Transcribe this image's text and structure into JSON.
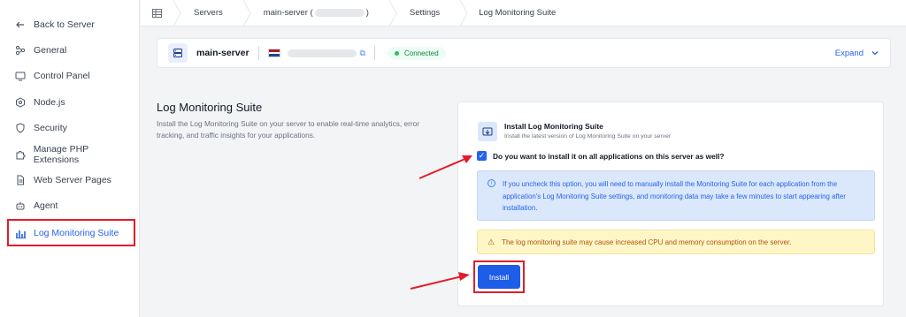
{
  "sidebar": {
    "items": [
      {
        "label": "Back to Server",
        "icon": "arrow-left-icon"
      },
      {
        "label": "General",
        "icon": "settings-nodes-icon"
      },
      {
        "label": "Control Panel",
        "icon": "monitor-icon"
      },
      {
        "label": "Node.js",
        "icon": "nodejs-icon"
      },
      {
        "label": "Security",
        "icon": "shield-icon"
      },
      {
        "label": "Manage PHP Extensions",
        "icon": "puzzle-icon"
      },
      {
        "label": "Web Server Pages",
        "icon": "document-icon"
      },
      {
        "label": "Agent",
        "icon": "robot-icon"
      },
      {
        "label": "Log Monitoring Suite",
        "icon": "bar-chart-icon"
      }
    ],
    "active_index": 8
  },
  "breadcrumb": {
    "items": [
      "Servers",
      "main-server (",
      ")",
      "Settings",
      "Log Monitoring Suite"
    ]
  },
  "server_header": {
    "name": "main-server",
    "status": "Connected",
    "expand_label": "Expand"
  },
  "section": {
    "title": "Log Monitoring Suite",
    "description": "Install the Log Monitoring Suite on your server to enable real-time analytics, error tracking, and traffic insights for your applications."
  },
  "install_panel": {
    "title": "Install Log Monitoring Suite",
    "subtitle": "Install the latest version of Log Monitoring Suite on your server",
    "checkbox_label": "Do you want to install it on all applications on this server as well?",
    "checkbox_checked": true,
    "info_text": "If you uncheck this option, you will need to manually install the Monitoring Suite for each application from the application's Log Monitoring Suite settings, and monitoring data may take a few minutes to start appearing after installation.",
    "warning_text": "The log monitoring suite may cause increased CPU and memory consumption on the server.",
    "install_label": "Install"
  },
  "colors": {
    "accent": "#2563eb",
    "highlight": "#e11d2a",
    "status_green": "#22c55e",
    "warning": "#b45309"
  }
}
